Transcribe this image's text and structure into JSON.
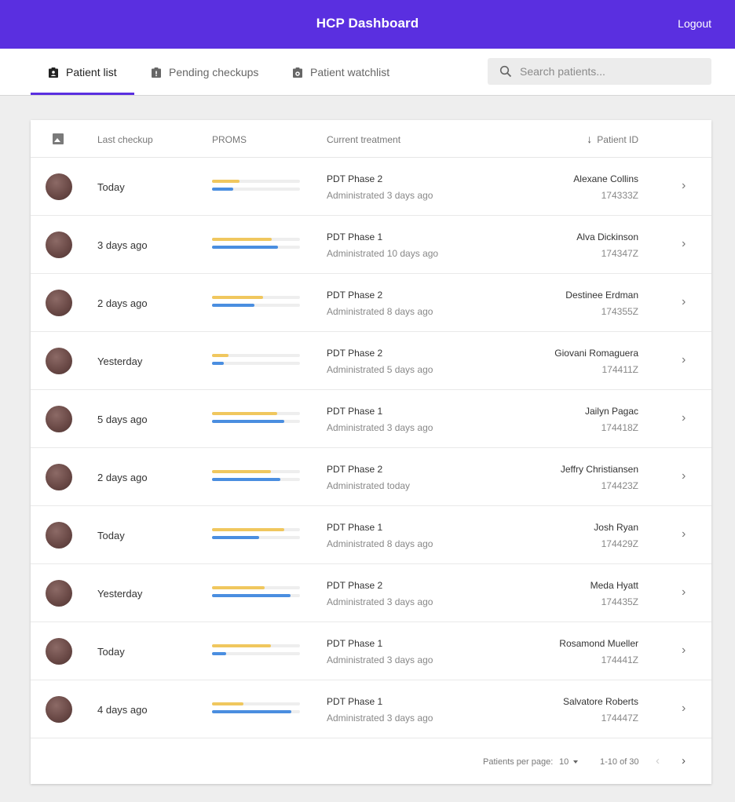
{
  "header": {
    "title": "HCP Dashboard",
    "logout_label": "Logout"
  },
  "tabs": [
    {
      "label": "Patient list",
      "icon": "clipboard-account-icon",
      "active": true
    },
    {
      "label": "Pending checkups",
      "icon": "clipboard-alert-icon",
      "active": false
    },
    {
      "label": "Patient watchlist",
      "icon": "clipboard-eye-icon",
      "active": false
    }
  ],
  "search": {
    "placeholder": "Search patients...",
    "value": "",
    "icon": "search-icon"
  },
  "table": {
    "columns": {
      "avatar_icon": "image-icon",
      "last_checkup": "Last checkup",
      "proms": "PROMS",
      "current_treatment": "Current treatment",
      "patient_id": "Patient ID",
      "sort_icon": "arrow-down-icon"
    },
    "rows": [
      {
        "last_checkup": "Today",
        "proms": [
          0.31,
          0.24
        ],
        "treatment": "PDT Phase 2",
        "administered": "Administrated 3 days ago",
        "name": "Alexane Collins",
        "id": "174333Z"
      },
      {
        "last_checkup": "3 days ago",
        "proms": [
          0.68,
          0.75
        ],
        "treatment": "PDT Phase 1",
        "administered": "Administrated 10 days ago",
        "name": "Alva Dickinson",
        "id": "174347Z"
      },
      {
        "last_checkup": "2 days ago",
        "proms": [
          0.58,
          0.48
        ],
        "treatment": "PDT Phase 2",
        "administered": "Administrated 8 days ago",
        "name": "Destinee Erdman",
        "id": "174355Z"
      },
      {
        "last_checkup": "Yesterday",
        "proms": [
          0.19,
          0.13
        ],
        "treatment": "PDT Phase 2",
        "administered": "Administrated 5 days ago",
        "name": "Giovani Romaguera",
        "id": "174411Z"
      },
      {
        "last_checkup": "5 days ago",
        "proms": [
          0.74,
          0.82
        ],
        "treatment": "PDT Phase 1",
        "administered": "Administrated 3 days ago",
        "name": "Jailyn Pagac",
        "id": "174418Z"
      },
      {
        "last_checkup": "2 days ago",
        "proms": [
          0.67,
          0.78
        ],
        "treatment": "PDT Phase 2",
        "administered": "Administrated today",
        "name": "Jeffry Christiansen",
        "id": "174423Z"
      },
      {
        "last_checkup": "Today",
        "proms": [
          0.82,
          0.54
        ],
        "treatment": "PDT Phase 1",
        "administered": "Administrated 8 days ago",
        "name": "Josh Ryan",
        "id": "174429Z"
      },
      {
        "last_checkup": "Yesterday",
        "proms": [
          0.6,
          0.89
        ],
        "treatment": "PDT Phase 2",
        "administered": "Administrated 3 days ago",
        "name": "Meda Hyatt",
        "id": "174435Z"
      },
      {
        "last_checkup": "Today",
        "proms": [
          0.67,
          0.16
        ],
        "treatment": "PDT Phase 1",
        "administered": "Administrated 3 days ago",
        "name": "Rosamond Mueller",
        "id": "174441Z"
      },
      {
        "last_checkup": "4 days ago",
        "proms": [
          0.36,
          0.9
        ],
        "treatment": "PDT Phase 1",
        "administered": "Administrated 3 days ago",
        "name": "Salvatore Roberts",
        "id": "174447Z"
      }
    ]
  },
  "pagination": {
    "per_page_label": "Patients per page:",
    "per_page_value": "10",
    "range": "1-10 of 30",
    "prev_icon": "chevron-left-icon",
    "next_icon": "chevron-right-icon"
  },
  "colors": {
    "accent": "#5a2fe0",
    "proms_primary": "#f0c75e",
    "proms_secondary": "#4a8ee0"
  }
}
